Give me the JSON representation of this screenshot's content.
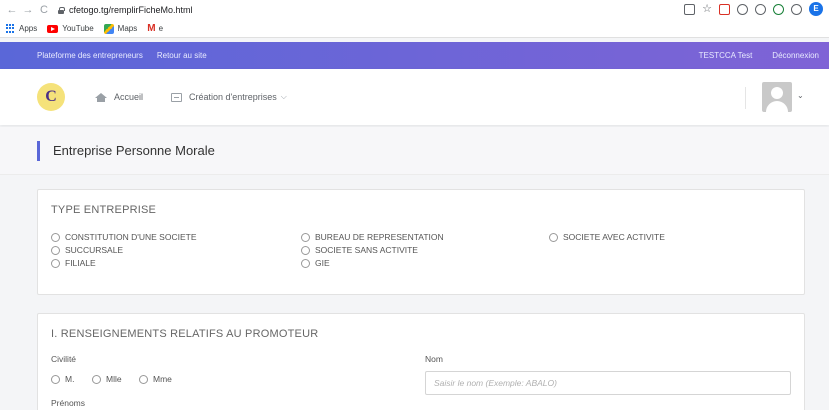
{
  "browser": {
    "url": "cfetogo.tg/remplirFicheMo.html",
    "profile_initial": "E"
  },
  "bookmarks": [
    {
      "label": "Apps"
    },
    {
      "label": "YouTube"
    },
    {
      "label": "Maps"
    },
    {
      "label": "e"
    }
  ],
  "topbar": {
    "platform": "Plateforme des entrepreneurs",
    "back_to_site": "Retour au site",
    "user": "TESTCCA Test",
    "logout": "Déconnexion",
    "color_start": "#5a67d8",
    "color_end": "#7f63d6"
  },
  "header": {
    "logo_text": "C",
    "nav": {
      "home": "Accueil",
      "creation": "Création d'entreprises"
    }
  },
  "page": {
    "title": "Entreprise Personne Morale"
  },
  "type_entreprise": {
    "title": "TYPE ENTREPRISE",
    "options": [
      "CONSTITUTION D'UNE SOCIETE",
      "SUCCURSALE",
      "FILIALE",
      "BUREAU DE REPRESENTATION",
      "SOCIETE SANS ACTIVITE",
      "GIE",
      "SOCIETE AVEC ACTIVITE"
    ]
  },
  "promoteur": {
    "title": "I. RENSEIGNEMENTS RELATIFS AU PROMOTEUR",
    "civilite_label": "Civilité",
    "civilite_options": [
      "M.",
      "Mlle",
      "Mme"
    ],
    "nom_label": "Nom",
    "nom_placeholder": "Saisir le nom (Exemple: ABALO)",
    "nom_value": "",
    "prenoms_label": "Prénoms"
  }
}
